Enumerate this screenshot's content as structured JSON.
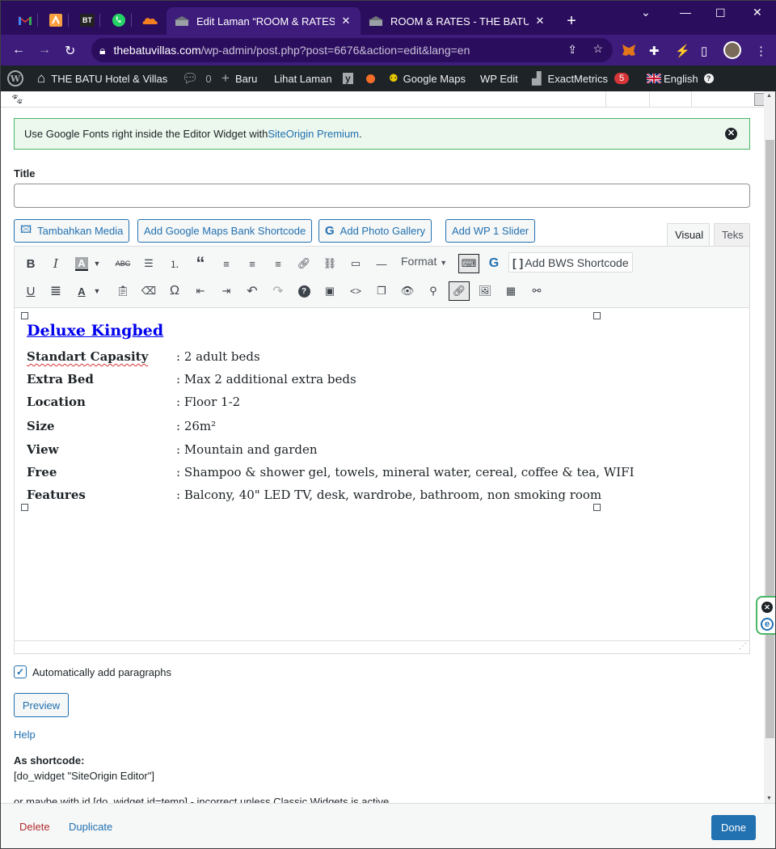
{
  "browser": {
    "tabs": [
      {
        "title": "Edit Laman “ROOM & RATES” ‹ TI",
        "active": true
      },
      {
        "title": "ROOM & RATES - THE BATU Hoti",
        "active": false
      }
    ],
    "pinned_bt_label": "BT",
    "url_domain": "thebatuvillas.com",
    "url_path": "/wp-admin/post.php?post=6676&action=edit&lang=en"
  },
  "adminbar": {
    "site_name": "THE BATU Hotel & Villas",
    "comments_count": "0",
    "new_label": "Baru",
    "view_page": "Lihat Laman",
    "google_maps": "Google Maps",
    "wp_edit": "WP Edit",
    "exactmetrics": "ExactMetrics",
    "exactmetrics_badge": "5",
    "language": "English"
  },
  "notice": {
    "text": "Use Google Fonts right inside the Editor Widget with ",
    "link": "SiteOrigin Premium",
    "suffix": "."
  },
  "title_label": "Title",
  "title_value": "",
  "media_buttons": {
    "add_media": "Tambahkan Media",
    "maps": "Add Google Maps Bank Shortcode",
    "gallery": "Add Photo Gallery",
    "slider": "Add WP 1 Slider"
  },
  "editor_tabs": {
    "visual": "Visual",
    "text": "Teks"
  },
  "toolbar": {
    "format": "Format",
    "bws": "Add BWS Shortcode"
  },
  "content": {
    "heading": "Deluxe Kingbed",
    "rows": [
      {
        "key": "Standart Capasity",
        "value": ": 2 adult beds"
      },
      {
        "key": "Extra Bed",
        "value": ": Max 2 additional extra beds"
      },
      {
        "key": "Location",
        "value": ": Floor 1-2"
      },
      {
        "key": "Size",
        "value": ": 26m²"
      },
      {
        "key": "View",
        "value": ": Mountain and garden"
      },
      {
        "key": "Free",
        "value": ": Shampoo & shower gel, towels, mineral water, cereal, coffee & tea, WIFI"
      },
      {
        "key": "Features",
        "value": ": Balcony, 40\" LED TV, desk, wardrobe, bathroom, non smoking room"
      }
    ]
  },
  "auto_paragraphs": "Automatically add paragraphs",
  "auto_paragraphs_checked": true,
  "preview": "Preview",
  "help": "Help",
  "shortcode_label": "As shortcode:",
  "shortcode_value": "[do_widget \"SiteOrigin Editor\"]",
  "shortcode_note": "or maybe with id [do_widget id=temp] - incorrect unless Classic Widgets is active",
  "footer": {
    "delete": "Delete",
    "duplicate": "Duplicate",
    "done": "Done"
  },
  "colors": {
    "accent": "#2271b1",
    "browser_dark": "#2b0d5e",
    "browser_mid": "#3e1c7c",
    "adminbar": "#1d2327",
    "notice_bg": "#ecf7ed",
    "notice_border": "#4ab866",
    "delete": "#b32d2e"
  }
}
